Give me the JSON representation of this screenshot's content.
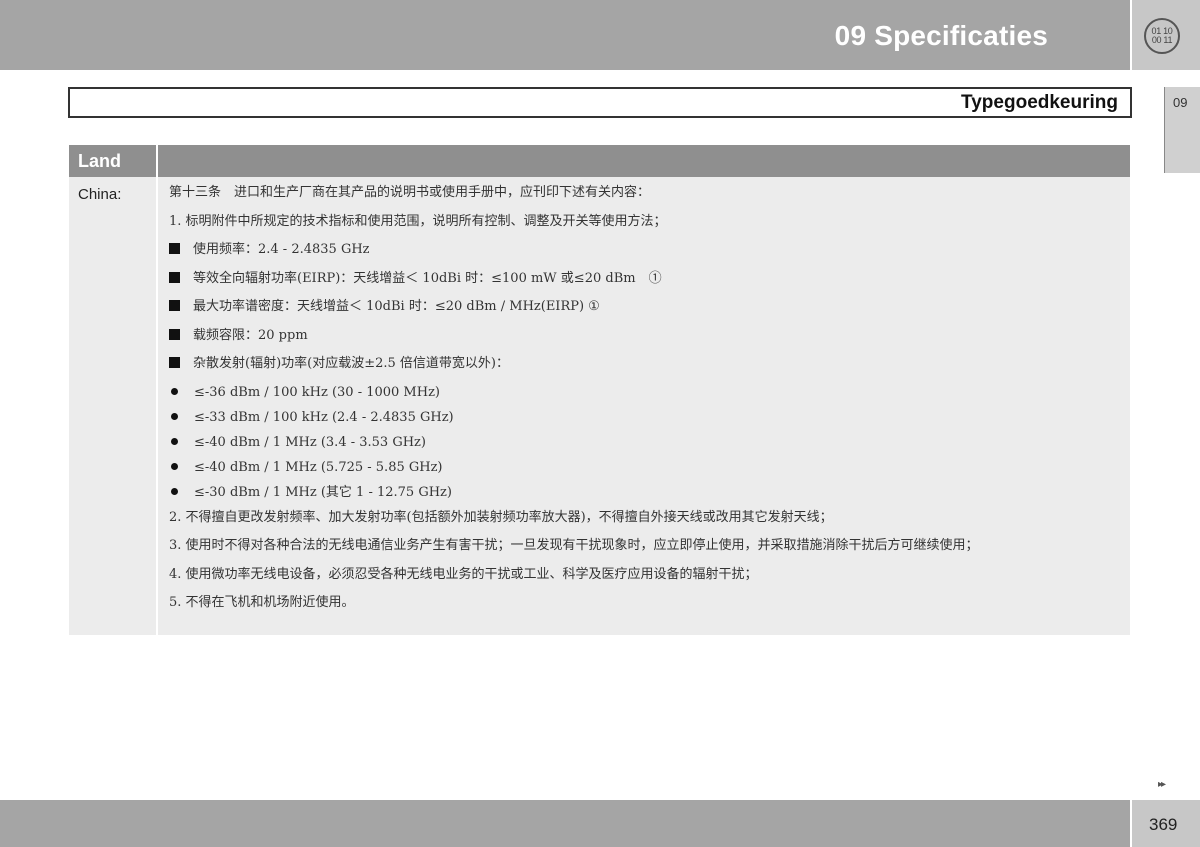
{
  "header": {
    "chapter_title": "09 Specificaties",
    "badge_top": "01 10",
    "badge_bottom": "00 11"
  },
  "section": {
    "title": "Typegoedkeuring",
    "side_tab": "09"
  },
  "table": {
    "headers": [
      "Land",
      ""
    ],
    "country": "China:",
    "lines": [
      {
        "type": "text",
        "text": "第十三条　进口和生产厂商在其产品的说明书或使用手册中，应刊印下述有关内容："
      },
      {
        "type": "text",
        "text": "1. 标明附件中所规定的技术指标和使用范围，说明所有控制、调整及开关等使用方法；"
      },
      {
        "type": "square",
        "text": "使用频率：2.4 - 2.4835 GHz"
      },
      {
        "type": "square",
        "text": "等效全向辐射功率(EIRP)：天线增益＜ 10dBi 时：≤100 mW 或≤20 dBm　①"
      },
      {
        "type": "square",
        "text": "最大功率谱密度：天线增益＜ 10dBi 时：≤20 dBm / MHz(EIRP) ①"
      },
      {
        "type": "square",
        "text": "载频容限：20 ppm"
      },
      {
        "type": "square",
        "text": "杂散发射(辐射)功率(对应载波±2.5 倍信道带宽以外)："
      },
      {
        "type": "dot",
        "text": "≤-36 dBm / 100 kHz (30 - 1000 MHz)"
      },
      {
        "type": "dot",
        "text": "≤-33 dBm / 100 kHz (2.4 - 2.4835 GHz)"
      },
      {
        "type": "dot",
        "text": "≤-40 dBm / 1 MHz (3.4 - 3.53 GHz)"
      },
      {
        "type": "dot",
        "text": "≤-40 dBm / 1 MHz (5.725 - 5.85 GHz)"
      },
      {
        "type": "dot",
        "text": "≤-30 dBm / 1 MHz (其它 1 - 12.75 GHz)"
      },
      {
        "type": "text",
        "text": "2. 不得擅自更改发射频率、加大发射功率(包括额外加装射频功率放大器)，不得擅自外接天线或改用其它发射天线；"
      },
      {
        "type": "text",
        "text": "3. 使用时不得对各种合法的无线电通信业务产生有害干扰；一旦发现有干扰现象时，应立即停止使用，并采取措施消除干扰后方可继续使用；"
      },
      {
        "type": "text",
        "text": "4. 使用微功率无线电设备，必须忍受各种无线电业务的干扰或工业、科学及医疗应用设备的辐射干扰；"
      },
      {
        "type": "text",
        "text": "5. 不得在飞机和机场附近使用。"
      }
    ]
  },
  "footer": {
    "continue_marker": "▸▸",
    "page_number": "369"
  }
}
